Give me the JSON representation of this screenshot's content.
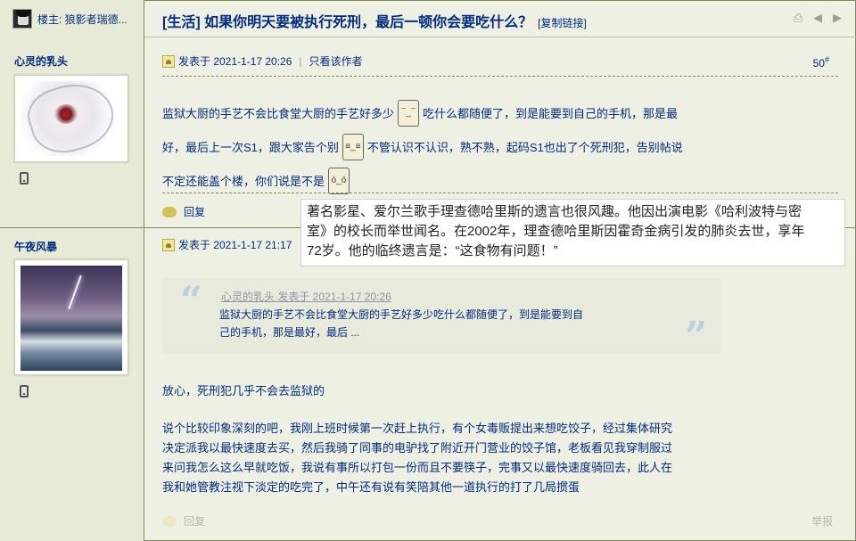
{
  "header": {
    "op_label": "楼主: 狼影者瑞德...",
    "title": "[生活] 如果你明天要被执行死刑，最后一顿你会要吃什么？",
    "copy_link": "[复制链接]",
    "icons": [
      "print-icon",
      "prev-icon",
      "next-icon"
    ]
  },
  "posts": [
    {
      "author": "心灵的乳头",
      "meta_posted": "发表于 2021-1-17 20:26",
      "meta_only_author": "只看该作者",
      "floor": "50",
      "floor_mark": "#",
      "lines": [
        "监狱大厨的手艺不会比食堂大厨的手艺好多少",
        "吃什么都随便了，到是能要到自己的手机，那是最",
        "好，最后上一次S1，跟大家告个别",
        "不管认识不认识，熟不熟，起码S1也出了个死刑犯，告别帖说",
        "不定还能盖个楼，你们说是不是"
      ],
      "reply_label": "回复"
    },
    {
      "author": "午夜风暴",
      "meta_posted": "发表于 2021-1-17 21:17",
      "quote_head": "心灵的乳头 发表于 2021-1-17 20:26",
      "quote_lines": [
        "监狱大厨的手艺不会比食堂大厨的手艺好多少吃什么都随便了，到是能要到自",
        "己的手机，那是最好，最后 ..."
      ],
      "line1": "放心，死刑犯几乎不会去监狱的",
      "paragraph": [
        "说个比较印象深刻的吧，我刚上班时候第一次赶上执行，有个女毒贩提出来想吃饺子，经过集体研究",
        "决定派我以最快速度去买，然后我骑了同事的电驴找了附近开门营业的饺子馆，老板看见我穿制服过",
        "来问我怎么这么早就吃饭，我说有事所以打包一份而且不要筷子，完事又以最快速度骑回去，此人在",
        "我和她管教注视下淡定的吃完了，中午还有说有笑陪其他一道执行的打了几局掼蛋"
      ],
      "reply_label": "回复",
      "report_label": "举报"
    }
  ],
  "tooltip": {
    "lines": [
      "著名影星、爱尔兰歌手理查德哈里斯的遗言也很风趣。他因出演电影《哈利波特与密",
      "室》的校长而举世闻名。在2002年，理查德哈里斯因霍奇金病引发的肺炎去世，享年",
      "72岁。他的临终遗言是：“这食物有问题！”"
    ]
  },
  "colors": {
    "link": "#022c80",
    "background": "#eef0e4",
    "sidebar": "#e6ead6",
    "border": "#7f8c58"
  }
}
